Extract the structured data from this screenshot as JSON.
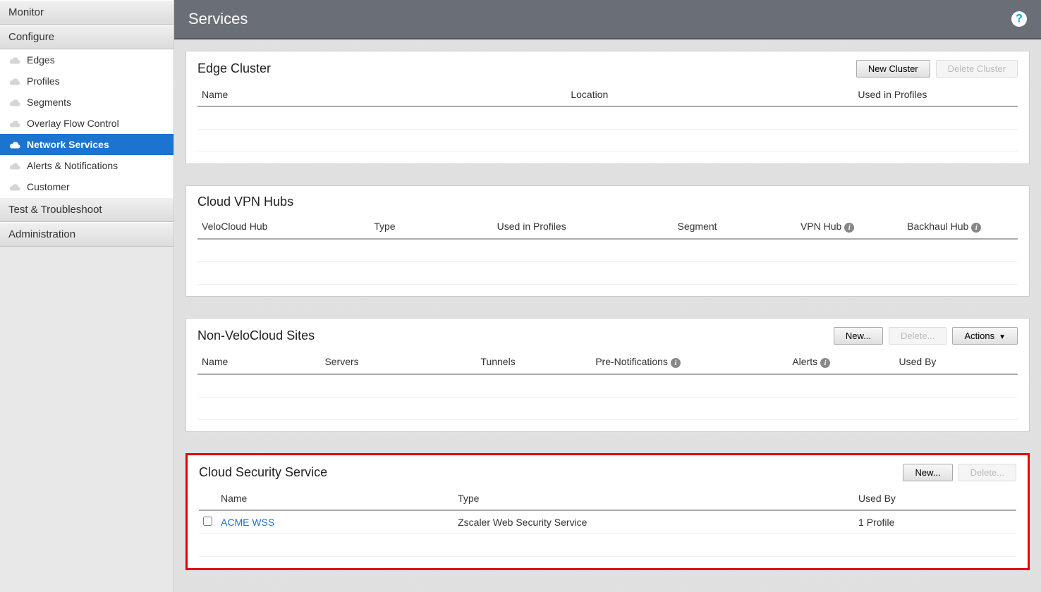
{
  "sidebar": {
    "groups": [
      {
        "label": "Monitor",
        "items": []
      },
      {
        "label": "Configure",
        "items": [
          {
            "label": "Edges"
          },
          {
            "label": "Profiles"
          },
          {
            "label": "Segments"
          },
          {
            "label": "Overlay Flow Control"
          },
          {
            "label": "Network Services",
            "active": true
          },
          {
            "label": "Alerts & Notifications"
          },
          {
            "label": "Customer"
          }
        ]
      },
      {
        "label": "Test & Troubleshoot",
        "items": []
      },
      {
        "label": "Administration",
        "items": []
      }
    ]
  },
  "page": {
    "title": "Services"
  },
  "panels": {
    "edge_cluster": {
      "title": "Edge Cluster",
      "buttons": {
        "new": "New Cluster",
        "delete": "Delete Cluster"
      },
      "columns": {
        "name": "Name",
        "location": "Location",
        "used_in_profiles": "Used in Profiles"
      }
    },
    "cloud_vpn_hubs": {
      "title": "Cloud VPN Hubs",
      "columns": {
        "hub": "VeloCloud Hub",
        "type": "Type",
        "used_in_profiles": "Used in Profiles",
        "segment": "Segment",
        "vpn_hub": "VPN Hub",
        "backhaul_hub": "Backhaul Hub"
      }
    },
    "non_velocloud_sites": {
      "title": "Non-VeloCloud Sites",
      "buttons": {
        "new": "New...",
        "delete": "Delete...",
        "actions": "Actions"
      },
      "columns": {
        "name": "Name",
        "servers": "Servers",
        "tunnels": "Tunnels",
        "pre_notifications": "Pre-Notifications",
        "alerts": "Alerts",
        "used_by": "Used By"
      }
    },
    "cloud_security_service": {
      "title": "Cloud Security Service",
      "buttons": {
        "new": "New...",
        "delete": "Delete..."
      },
      "columns": {
        "name": "Name",
        "type": "Type",
        "used_by": "Used By"
      },
      "rows": [
        {
          "name": "ACME WSS",
          "type": "Zscaler Web Security Service",
          "used_by": "1 Profile"
        }
      ]
    }
  }
}
